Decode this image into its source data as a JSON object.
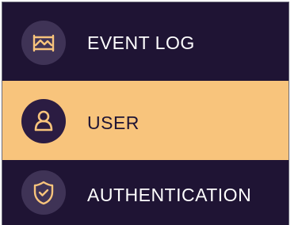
{
  "menu": {
    "items": [
      {
        "label": "EVENT LOG",
        "icon": "event-log-icon",
        "state": "default"
      },
      {
        "label": "USER",
        "icon": "user-icon",
        "state": "selected"
      },
      {
        "label": "AUTHENTICATION",
        "icon": "shield-check-icon",
        "state": "default"
      }
    ]
  },
  "colors": {
    "background": "#1f1434",
    "selected_background": "#f8c47c",
    "icon_circle": "#3f3356",
    "selected_icon_circle": "#2b1c42",
    "icon_stroke": "#f8c47c",
    "text": "#ffffff",
    "selected_text": "#1f1434"
  }
}
